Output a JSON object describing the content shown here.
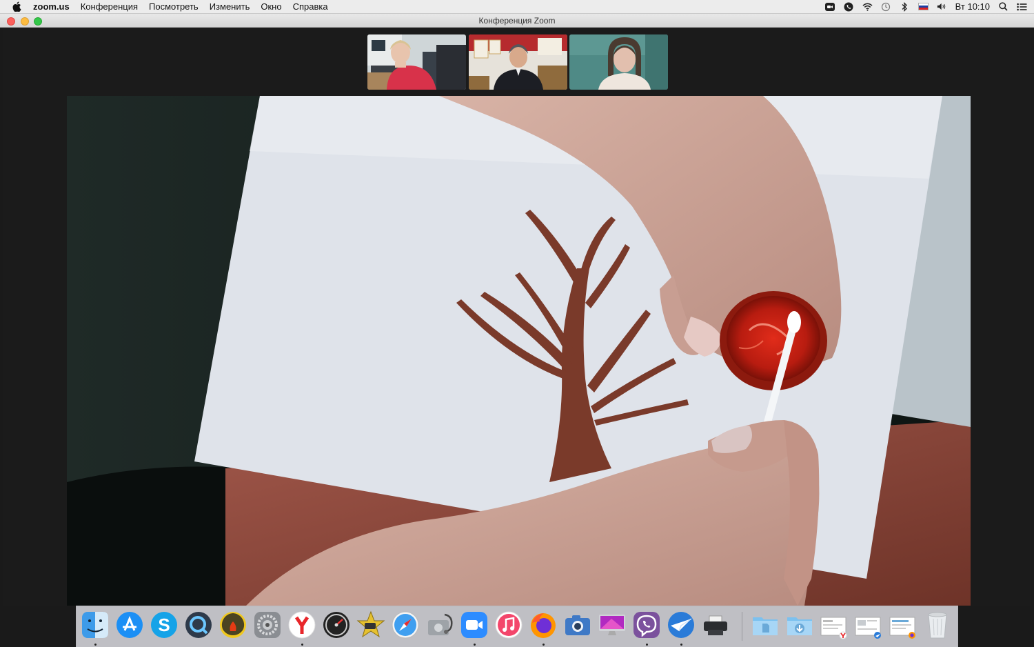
{
  "menubar": {
    "app_name": "zoom.us",
    "menus": [
      "Конференция",
      "Посмотреть",
      "Изменить",
      "Окно",
      "Справка"
    ],
    "clock": "Вт 10:10",
    "tray_icons": [
      "zoom-tray-icon",
      "viber-tray-icon",
      "wifi-icon",
      "time-machine-icon",
      "bluetooth-icon",
      "russian-flag-input-icon",
      "volume-icon",
      "spotlight-search-icon",
      "notification-center-icon"
    ]
  },
  "window": {
    "title": "Конференция Zoom"
  },
  "participants": [
    {
      "id": "participant-1"
    },
    {
      "id": "participant-2"
    },
    {
      "id": "participant-3"
    }
  ],
  "dock": {
    "apps": [
      "finder",
      "app-store",
      "skype",
      "quicktime",
      "burn",
      "system-preferences",
      "yandex-browser",
      "activity-monitor",
      "imovie",
      "safari",
      "disk-utility",
      "zoom",
      "itunes",
      "firefox",
      "image-capture",
      "imac-display",
      "viber",
      "mail-plane",
      "printer"
    ],
    "stacks": [
      "documents-folder",
      "downloads-folder",
      "document-stack-1",
      "document-stack-2",
      "document-stack-3",
      "trash"
    ]
  },
  "colors": {
    "menubar_bg": "#ececec",
    "app_bg": "#1b1b1b",
    "close": "#fc605c",
    "minimize": "#fdbc40",
    "maximize": "#34c84a"
  }
}
